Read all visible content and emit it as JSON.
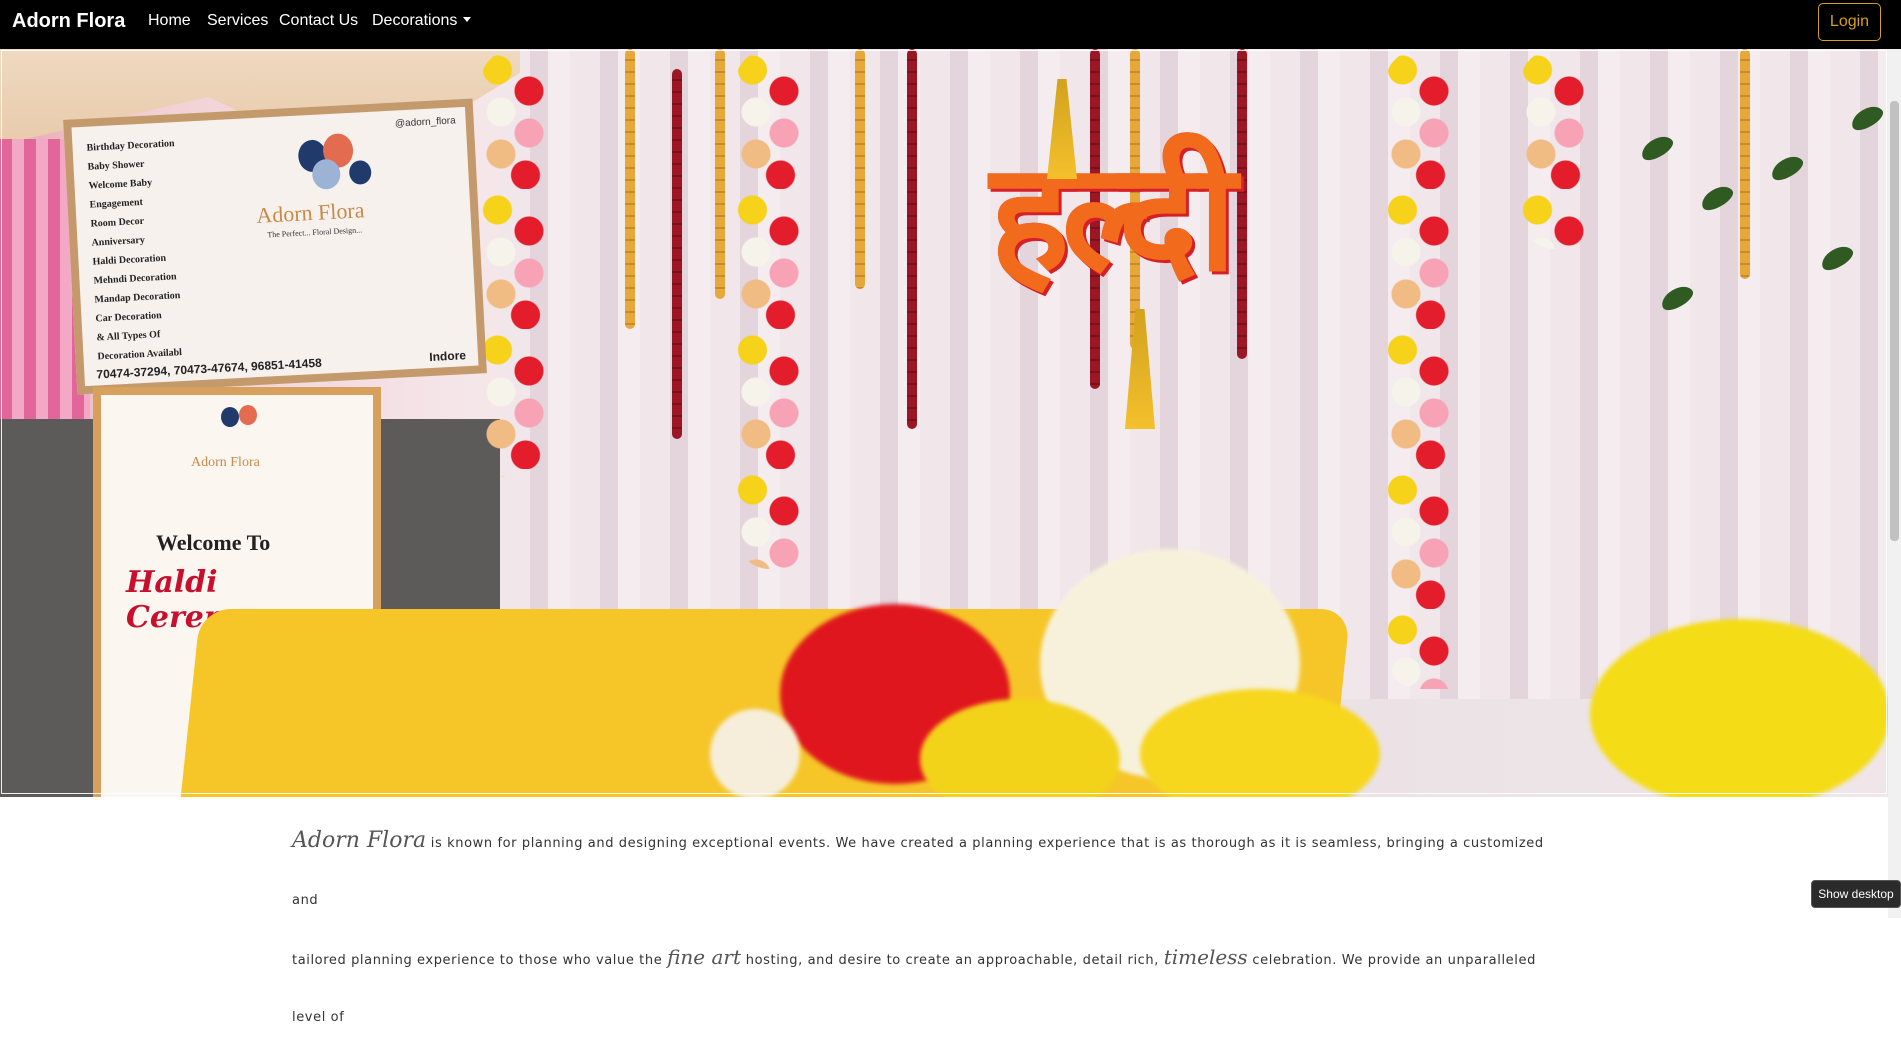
{
  "navbar": {
    "brand": "Adorn Flora",
    "links": [
      "Home",
      "Services",
      "Contact Us",
      "Decorations"
    ],
    "login_label": "Login",
    "accent_color": "#d4a017"
  },
  "hero": {
    "board1_services": [
      "Birthday Decoration",
      "Baby Shower",
      "Welcome Baby",
      "Engagement",
      "Room Decor",
      "Anniversary",
      "Haldi Decoration",
      "Mehndi Decoration",
      "Mandap Decoration",
      "Car Decoration",
      "& All Types Of",
      "Decoration Availabl"
    ],
    "board1_handle": "@adorn_flora",
    "board1_logo": "Adorn Flora",
    "board1_tagline": "The Perfect... Floral Design...",
    "board1_phones": "70474-37294, 70473-47674, 96851-41458",
    "board1_city": "Indore",
    "board2_logo": "Adorn Flora",
    "board2_welcome": "Welcome To",
    "board2_haldi": "Haldi Ceremony",
    "sign_text": "हल्दी"
  },
  "intro": {
    "brand_script": "Adorn Flora",
    "line1": " is known for planning and designing exceptional events. We have created a planning experience that is as thorough as it is seamless, bringing a customized and",
    "line2_a": "tailored planning experience to those who value the ",
    "fine_art": "fine art",
    "line2_b": " hosting, and desire to create an approachable, detail rich, ",
    "timeless": "timeless",
    "line2_c": " celebration. We provide an unparalleled level of"
  },
  "tooltip": "Show desktop"
}
